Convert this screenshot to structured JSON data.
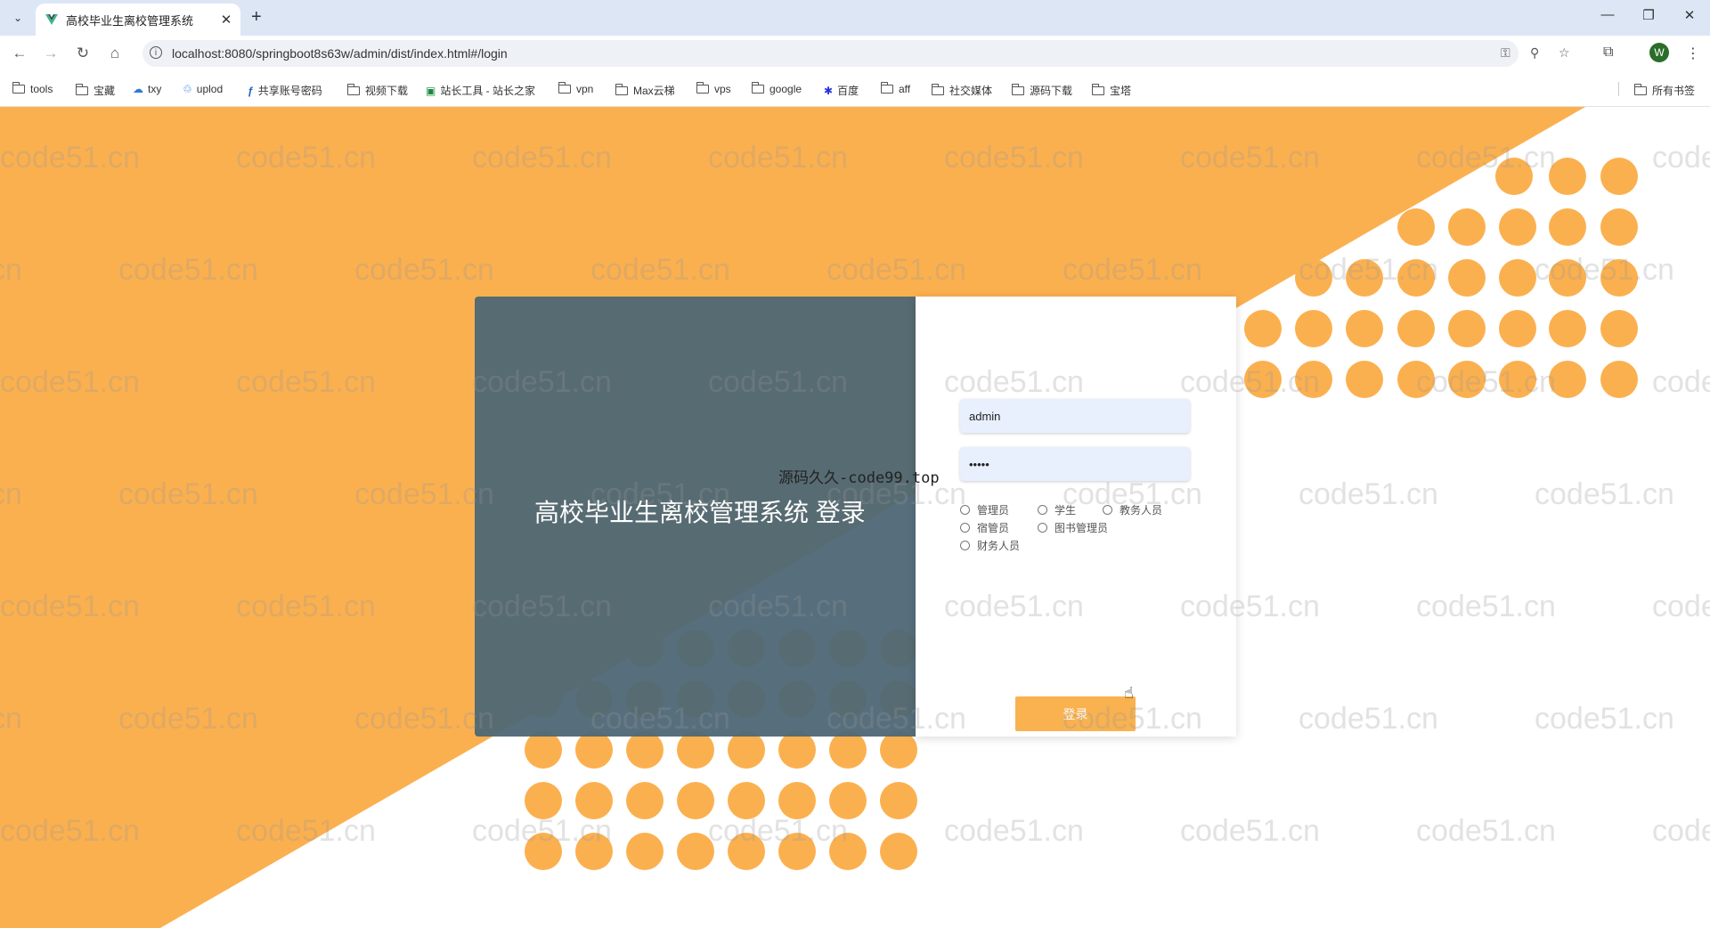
{
  "browser": {
    "tab_title": "高校毕业生离校管理系统",
    "tab_close": "✕",
    "new_tab": "+",
    "url": "localhost:8080/springboot8s63w/admin/dist/index.html#/login",
    "profile_initial": "W",
    "window_controls": {
      "minimize": "—",
      "restore": "❐",
      "close": "✕"
    }
  },
  "bookmarks": [
    {
      "label": "tools",
      "icon": "folder-icon"
    },
    {
      "label": "宝藏",
      "icon": "folder-icon"
    },
    {
      "label": "txy",
      "icon": "cloud-icon"
    },
    {
      "label": "uplod",
      "icon": "share-icon"
    },
    {
      "label": "共享账号密码",
      "icon": "app-icon"
    },
    {
      "label": "视频下载",
      "icon": "folder-icon"
    },
    {
      "label": "站长工具 - 站长之家",
      "icon": "site-icon"
    },
    {
      "label": "vpn",
      "icon": "folder-icon"
    },
    {
      "label": "Max云梯",
      "icon": "folder-icon"
    },
    {
      "label": "vps",
      "icon": "folder-icon"
    },
    {
      "label": "google",
      "icon": "folder-icon"
    },
    {
      "label": "百度",
      "icon": "baidu-icon"
    },
    {
      "label": "aff",
      "icon": "folder-icon"
    },
    {
      "label": "社交媒体",
      "icon": "folder-icon"
    },
    {
      "label": "源码下载",
      "icon": "folder-icon"
    },
    {
      "label": "宝塔",
      "icon": "folder-icon"
    }
  ],
  "all_bookmarks_label": "所有书签",
  "watermark_text": "code51.cn",
  "login": {
    "title": "高校毕业生离校管理系统 登录",
    "username_value": "admin",
    "password_value": "•••••",
    "side_text": "源码久久-code99.top",
    "roles": [
      "管理员",
      "学生",
      "教务人员",
      "宿管员",
      "图书管理员",
      "财务人员"
    ],
    "submit_label": "登录"
  },
  "colors": {
    "accent_orange": "#f9b24f",
    "panel_slate": "#4d6675",
    "bg_orange": "#fbb04f"
  }
}
